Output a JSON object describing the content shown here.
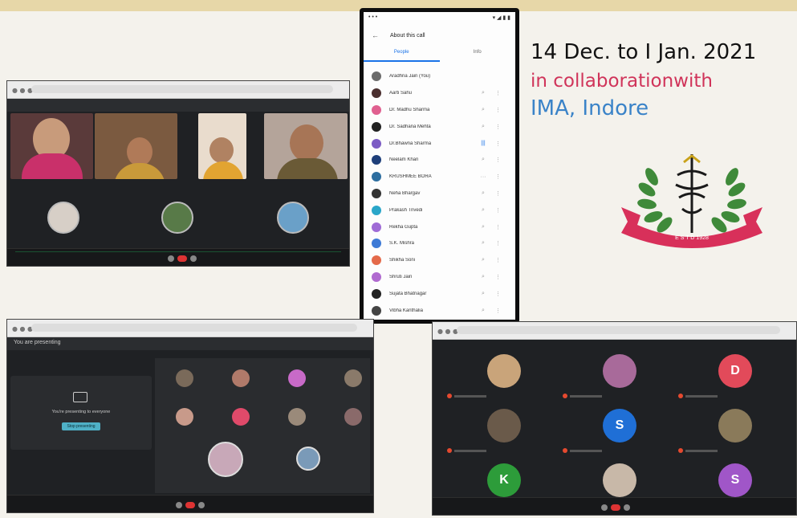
{
  "event": {
    "dates": "14 Dec. to I Jan. 2021",
    "collaboration": "in collaborationwith",
    "partner": "IMA, Indore",
    "logo_year": "E S T D 1928"
  },
  "phone": {
    "header_title": "About this call",
    "tabs": [
      "People",
      "Info"
    ],
    "participants": [
      {
        "name": "Aradhna Jain (You)",
        "color": "#6b6b6b",
        "mic": ""
      },
      {
        "name": "Aarti Sahu",
        "color": "#4a2f2f",
        "mic": "mic-off"
      },
      {
        "name": "Dr. Madhu Sharma",
        "color": "#e06090",
        "mic": "mic-off"
      },
      {
        "name": "Dr. Sadhana Mehta",
        "color": "#222222",
        "mic": "mic-off"
      },
      {
        "name": "Dr.Bhawna Sharma",
        "color": "#7c5cc4",
        "mic": "speaking"
      },
      {
        "name": "Neelam Khan",
        "color": "#1e3f7a",
        "mic": "mic-off"
      },
      {
        "name": "KRUSHMEE BORA",
        "color": "#2d6ea0",
        "mic": "more"
      },
      {
        "name": "Neha Bhargav",
        "color": "#333333",
        "mic": "mic-off"
      },
      {
        "name": "Prakash Trivedi",
        "color": "#2aa6c9",
        "mic": "mic-off"
      },
      {
        "name": "Rekha Gupta",
        "color": "#9f6bd6",
        "mic": "mic-off"
      },
      {
        "name": "S.K. Mishra",
        "color": "#3d7ad6",
        "mic": "mic-off"
      },
      {
        "name": "Shikha Soni",
        "color": "#e46a4a",
        "mic": "mic-off"
      },
      {
        "name": "Shruti Jain",
        "color": "#b06ad0",
        "mic": "mic-off"
      },
      {
        "name": "Sujata Bhatnagar",
        "color": "#222222",
        "mic": "mic-off"
      },
      {
        "name": "Vibha Kanthalia",
        "color": "#444444",
        "mic": "mic-off"
      }
    ]
  },
  "screen3": {
    "presenting_title": "You are presenting",
    "presenting_msg": "You're presenting to everyone",
    "stop_btn": "Stop presenting"
  },
  "screen4": {
    "avatars": [
      {
        "letter": "",
        "color": "#c9a47a"
      },
      {
        "letter": "",
        "color": "#a86a9a"
      },
      {
        "letter": "D",
        "color": "#e24a5a"
      },
      {
        "letter": "",
        "color": "#6a5a4a"
      },
      {
        "letter": "S",
        "color": "#1f6fd6"
      },
      {
        "letter": "",
        "color": "#8a7a5a"
      },
      {
        "letter": "K",
        "color": "#2d9c3a"
      },
      {
        "letter": "",
        "color": "#c8b8a8"
      },
      {
        "letter": "S",
        "color": "#a056c8"
      }
    ]
  }
}
